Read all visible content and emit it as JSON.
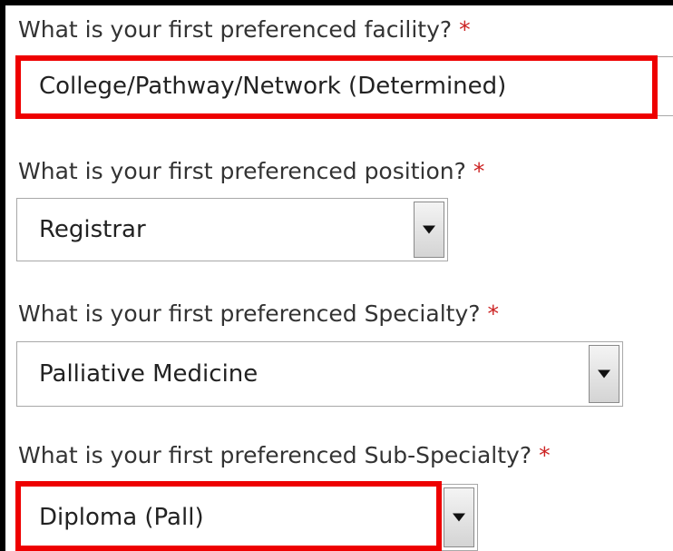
{
  "form": {
    "required_marker": "*",
    "questions": [
      {
        "label": "What is your first preferenced facility?",
        "selected_value": "College/Pathway/Network (Determined)",
        "highlighted": true
      },
      {
        "label": "What is your first preferenced position?",
        "selected_value": "Registrar",
        "highlighted": false
      },
      {
        "label": "What is your first preferenced Specialty?",
        "selected_value": "Palliative Medicine",
        "highlighted": false
      },
      {
        "label": "What is your first preferenced Sub-Specialty?",
        "selected_value": "Diploma (Pall)",
        "highlighted": true
      }
    ]
  },
  "colors": {
    "highlight": "#ee0000",
    "required": "#cc2222",
    "label_text": "#333333"
  },
  "icons": {
    "dropdown_arrow": "chevron-down-icon"
  }
}
